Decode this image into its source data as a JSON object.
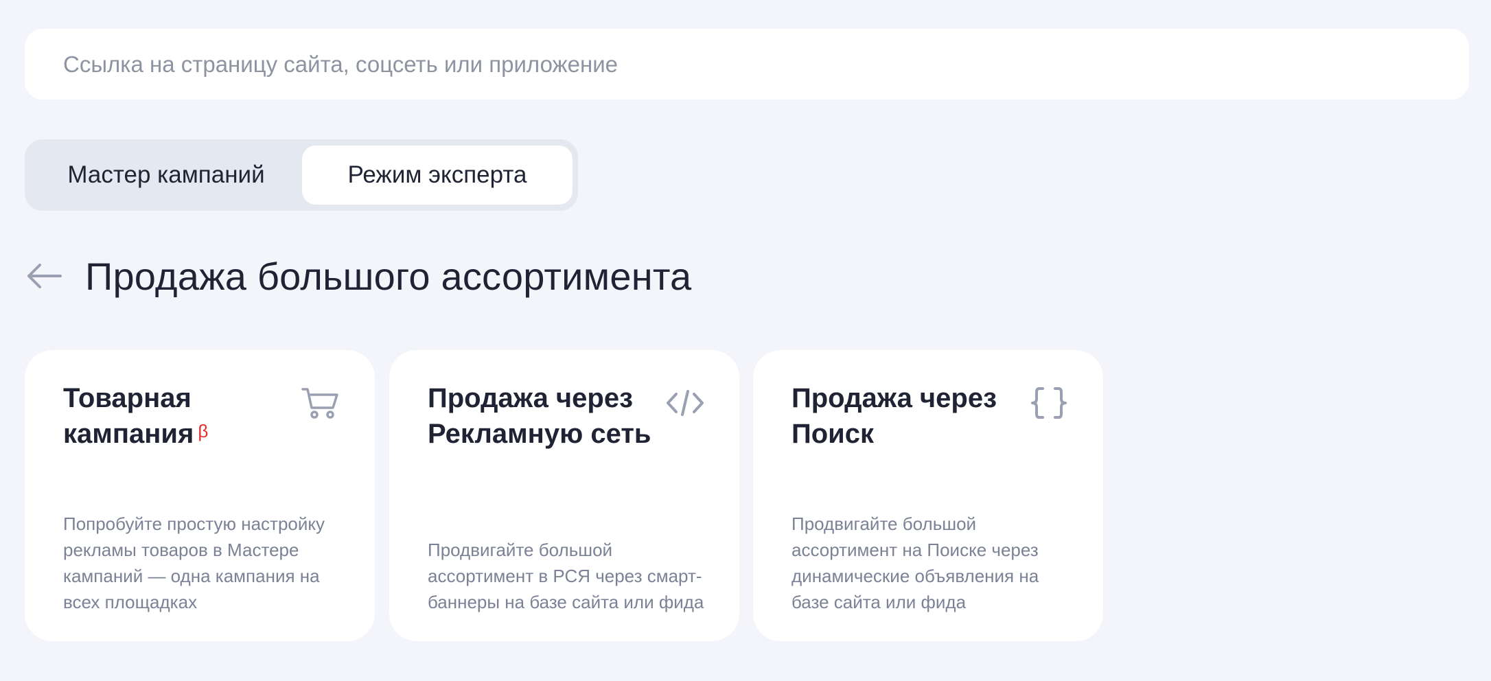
{
  "url_input": {
    "placeholder": "Ссылка на страницу сайта, соцсеть или приложение",
    "value": ""
  },
  "mode_toggle": {
    "options": [
      {
        "label": "Мастер кампаний",
        "selected": false
      },
      {
        "label": "Режим эксперта",
        "selected": true
      }
    ]
  },
  "header": {
    "back_icon": "arrow-left-icon",
    "title": "Продажа большого ассортимента"
  },
  "cards": [
    {
      "title": "Товарная кампания",
      "badge": "β",
      "icon": "shopping-cart-icon",
      "description": "Попробуйте простую настройку рекламы товаров в Мастере кампаний — одна кампания на всех площадках"
    },
    {
      "title": "Продажа через Рекламную сеть",
      "icon": "code-tag-icon",
      "description": "Продвигайте большой ассортимент в РСЯ через смарт-баннеры на базе сайта или фида"
    },
    {
      "title": "Продажа через Поиск",
      "icon": "curly-braces-icon",
      "description": "Продвигайте большой ассортимент на Поиске через динамические объявления на базе сайта или фида"
    }
  ],
  "colors": {
    "background": "#f3f5fa",
    "surface": "#ffffff",
    "toggle_track": "#e4e8f0",
    "text_primary": "#1f2333",
    "text_secondary": "#7b8296",
    "icon": "#9aa0b2",
    "beta_badge": "#e52b2b"
  }
}
